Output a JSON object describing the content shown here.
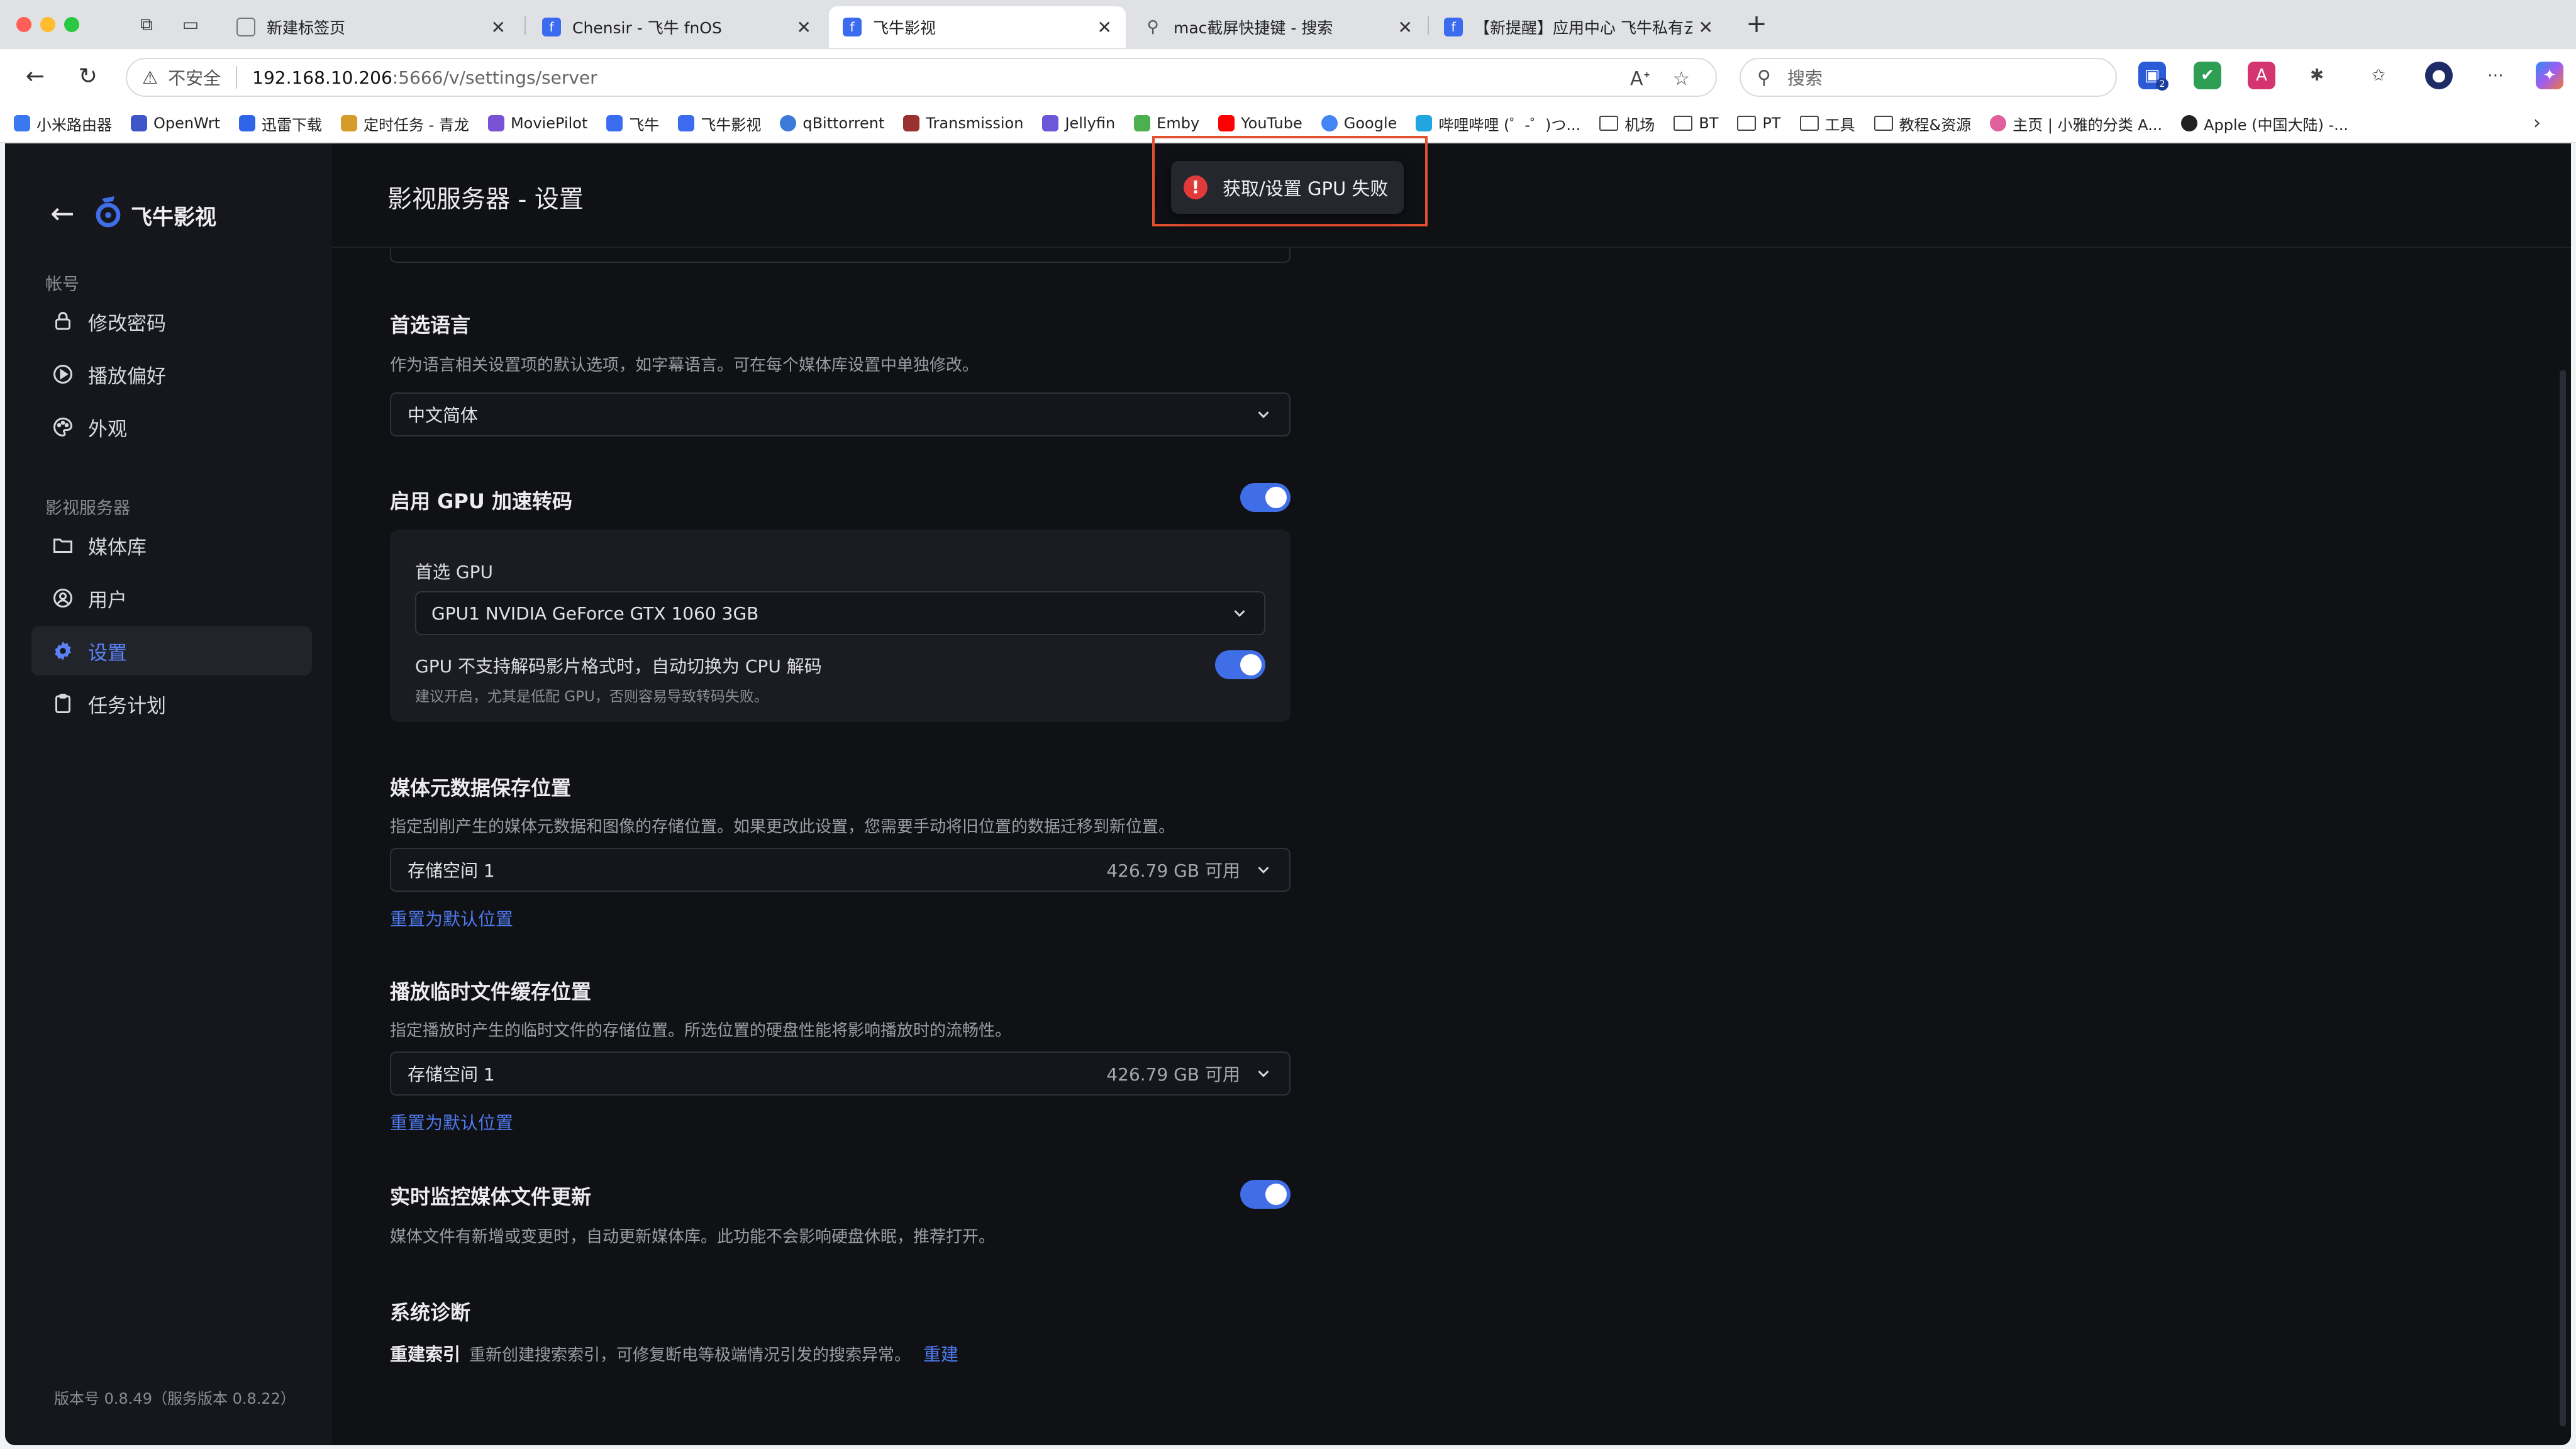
{
  "browser": {
    "tabs": [
      {
        "title": "新建标签页",
        "active": false
      },
      {
        "title": "Chensir - 飞牛 fnOS",
        "active": false
      },
      {
        "title": "飞牛影视",
        "active": true
      },
      {
        "title": "mac截屏快捷键 - 搜索",
        "active": false
      },
      {
        "title": "【新提醒】应用中心 飞牛私有云t",
        "active": false
      }
    ],
    "tab_close_glyph": "✕",
    "new_tab_glyph": "+",
    "insecure_label": "不安全",
    "url_host": "192.168.10.206",
    "url_path": ":5666/v/settings/server",
    "search_placeholder": "搜索",
    "extension_badge": "2",
    "bookmarks": [
      {
        "label": "小米路由器",
        "icon": "router-icon",
        "color": "#3a78f2"
      },
      {
        "label": "OpenWrt",
        "icon": "openwrt-icon",
        "color": "#3f56c9"
      },
      {
        "label": "迅雷下载",
        "icon": "thunder-icon",
        "color": "#2f63e8"
      },
      {
        "label": "定时任务 - 青龙",
        "icon": "qinglong-icon",
        "color": "#d79b2a"
      },
      {
        "label": "MoviePilot",
        "icon": "moviepilot-icon",
        "color": "#7a52d6"
      },
      {
        "label": "飞牛",
        "icon": "fnos-icon",
        "color": "#3b6cf0"
      },
      {
        "label": "飞牛影视",
        "icon": "fnos-video-icon",
        "color": "#3b6cf0"
      },
      {
        "label": "qBittorrent",
        "icon": "qbittorrent-icon",
        "color": "#3c7ad8"
      },
      {
        "label": "Transmission",
        "icon": "transmission-icon",
        "color": "#9b3030"
      },
      {
        "label": "Jellyfin",
        "icon": "jellyfin-icon",
        "color": "#6b57d8"
      },
      {
        "label": "Emby",
        "icon": "emby-icon",
        "color": "#4caf50"
      },
      {
        "label": "YouTube",
        "icon": "youtube-icon",
        "color": "#ff0000"
      },
      {
        "label": "Google",
        "icon": "google-icon",
        "color": "#4285f4"
      },
      {
        "label": "哔哩哔哩 (゜-゜)つ...",
        "icon": "bilibili-icon",
        "color": "#22a6e2"
      }
    ],
    "bookmark_folders": [
      "机场",
      "BT",
      "PT",
      "工具",
      "教程&资源"
    ],
    "bookmarks_tail": [
      {
        "label": "主页 | 小雅的分类 A...",
        "icon": "xiaoya-icon",
        "color": "#e0609a"
      },
      {
        "label": "Apple (中国大陆) -...",
        "icon": "apple-icon",
        "color": "#222222"
      }
    ]
  },
  "app": {
    "name": "飞牛影视",
    "page_title": "影视服务器 - 设置",
    "version": "版本号 0.8.49（服务版本 0.8.22）",
    "sidebar": {
      "account_group": "帐号",
      "account_items": [
        {
          "label": "修改密码",
          "icon": "lock-icon"
        },
        {
          "label": "播放偏好",
          "icon": "play-circle-icon"
        },
        {
          "label": "外观",
          "icon": "palette-icon"
        }
      ],
      "server_group": "影视服务器",
      "server_items": [
        {
          "label": "媒体库",
          "icon": "folder-icon"
        },
        {
          "label": "用户",
          "icon": "user-circle-icon"
        },
        {
          "label": "设置",
          "icon": "gear-icon",
          "active": true
        },
        {
          "label": "任务计划",
          "icon": "clipboard-icon"
        }
      ]
    },
    "settings": {
      "language": {
        "title": "首选语言",
        "desc": "作为语言相关设置项的默认选项，如字幕语言。可在每个媒体库设置中单独修改。",
        "value": "中文简体"
      },
      "gpu": {
        "title": "启用 GPU 加速转码",
        "enabled": true,
        "preferred_label": "首选 GPU",
        "preferred_value": "GPU1 NVIDIA GeForce GTX 1060 3GB",
        "fallback_label": "GPU 不支持解码影片格式时，自动切换为 CPU 解码",
        "fallback_enabled": true,
        "fallback_desc": "建议开启，尤其是低配 GPU，否则容易导致转码失败。"
      },
      "metadata": {
        "title": "媒体元数据保存位置",
        "desc": "指定刮削产生的媒体元数据和图像的存储位置。如果更改此设置，您需要手动将旧位置的数据迁移到新位置。",
        "value": "存储空间 1",
        "free": "426.79 GB 可用",
        "reset": "重置为默认位置"
      },
      "cache": {
        "title": "播放临时文件缓存位置",
        "desc": "指定播放时产生的临时文件的存储位置。所选位置的硬盘性能将影响播放时的流畅性。",
        "value": "存储空间 1",
        "free": "426.79 GB 可用",
        "reset": "重置为默认位置"
      },
      "monitor": {
        "title": "实时监控媒体文件更新",
        "enabled": true,
        "desc": "媒体文件有新增或变更时，自动更新媒体库。此功能不会影响硬盘休眠，推荐打开。"
      },
      "diagnostics": {
        "title": "系统诊断",
        "reindex_label": "重建索引",
        "reindex_desc": "重新创建搜索索引，可修复断电等极端情况引发的搜索异常。",
        "reindex_action": "重建"
      }
    },
    "toast": {
      "icon": "!",
      "message": "获取/设置 GPU 失败"
    }
  },
  "colors": {
    "accent": "#3f6ee6",
    "link": "#4f7bf0",
    "error": "#e03a3a",
    "highlight_box": "#e2502f"
  }
}
